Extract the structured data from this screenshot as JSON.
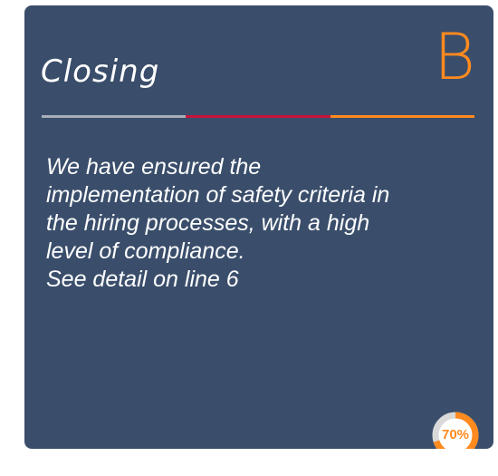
{
  "card": {
    "title": "Closing",
    "grade": "B",
    "divider_colors": [
      "#a7aeb8",
      "#c8143c",
      "#ff8a1e"
    ],
    "body_lines": [
      "We have ensured the",
      "implementation of safety criteria in",
      "the hiring processes, with a high",
      "level of compliance.",
      "See detail on line 6"
    ],
    "progress": {
      "label": "70%",
      "value": 0.7,
      "fill_color": "#ff8a1e",
      "track_color": "#d9d9d9"
    }
  }
}
